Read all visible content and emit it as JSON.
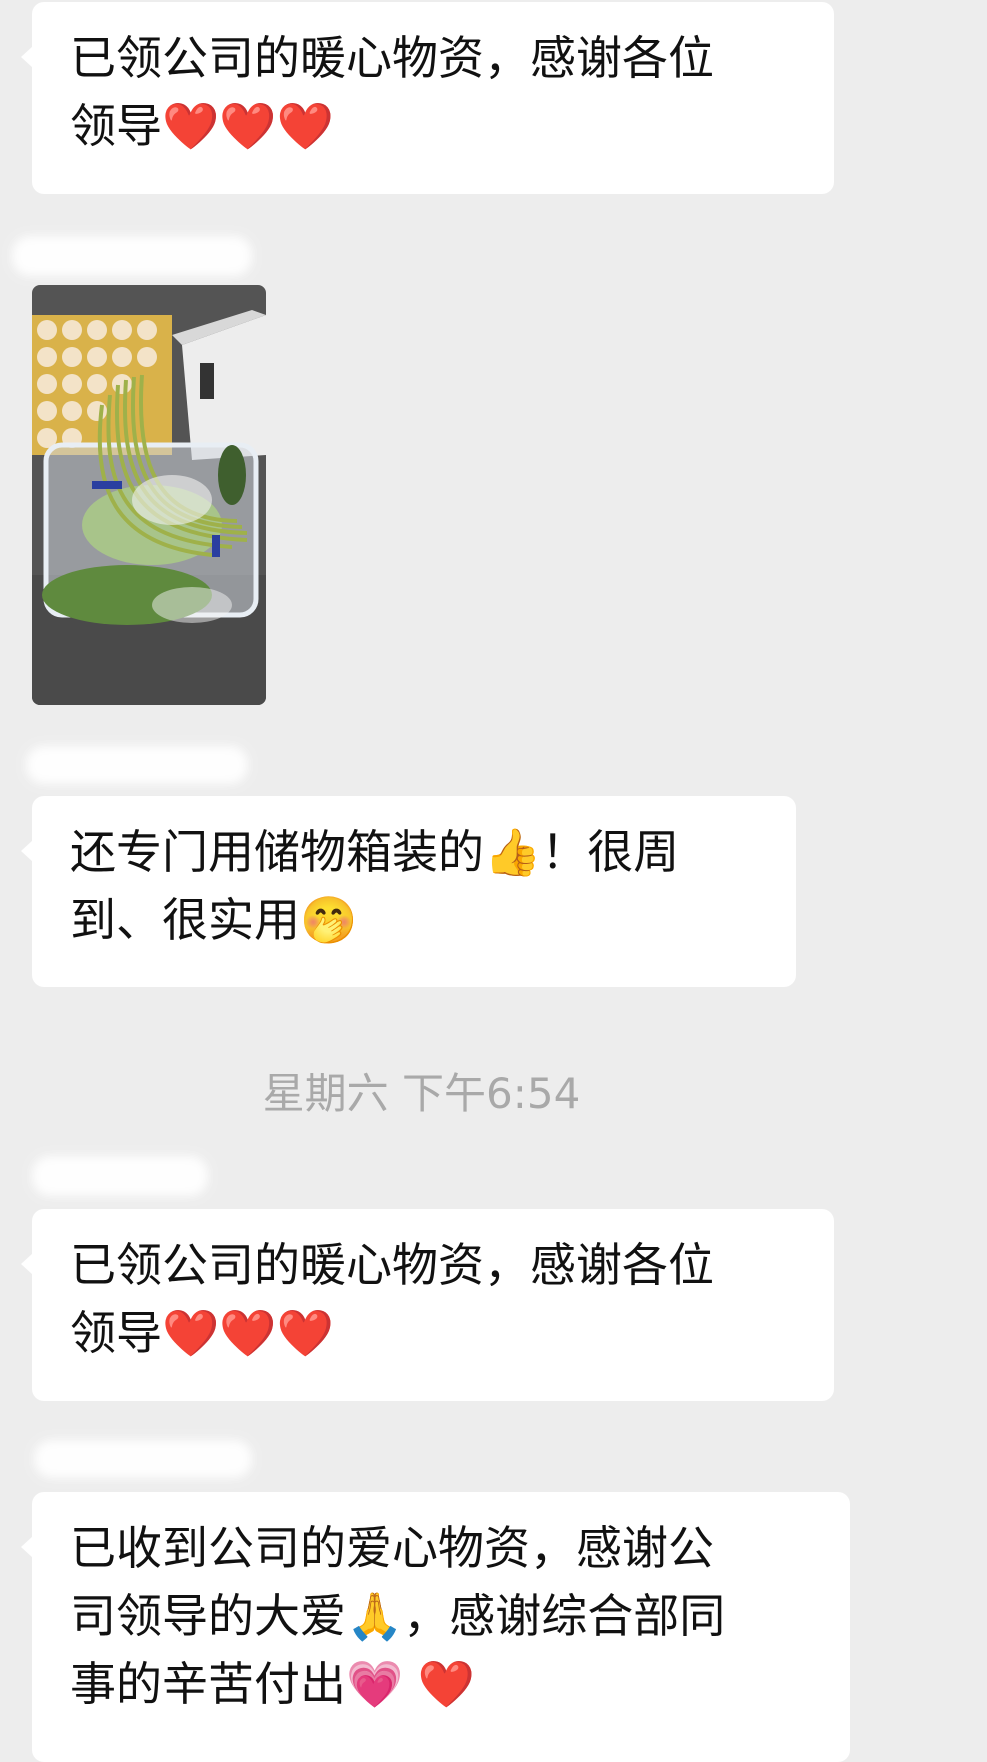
{
  "messages": [
    {
      "lines": [
        "已领公司的暖心物资，感谢各位",
        "领导❤️❤️❤️"
      ]
    },
    {
      "lines": [
        "还专门用储物箱装的👍！很周",
        "到、很实用🤭"
      ]
    },
    {
      "lines": [
        "已领公司的暖心物资，感谢各位",
        "领导❤️❤️❤️"
      ]
    },
    {
      "lines": [
        "已收到公司的爱心物资，感谢公",
        "司领导的大爱🙏，感谢综合部同",
        "事的辛苦付出💗 ❤️"
      ]
    }
  ],
  "timestamp": "星期六 下午6:54",
  "colors": {
    "background": "#ededed",
    "bubble": "#ffffff",
    "timestamp": "#a9a9a9",
    "text": "#111111"
  }
}
